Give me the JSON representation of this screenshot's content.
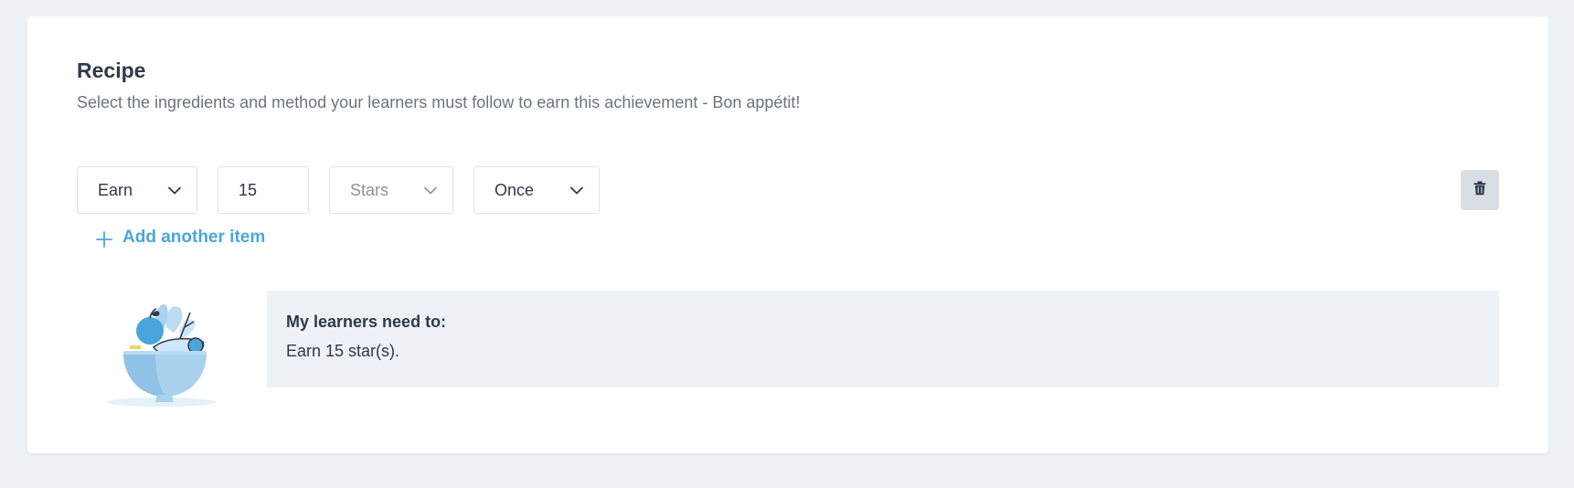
{
  "recipe": {
    "title": "Recipe",
    "subtitle": "Select the ingredients and method your learners must follow to earn this achievement - Bon appétit!"
  },
  "rule": {
    "action": "Earn",
    "amount": "15",
    "unit": "Stars",
    "frequency": "Once"
  },
  "add_item_label": "Add another item",
  "summary": {
    "heading": "My learners need to:",
    "text": "Earn 15 star(s)."
  },
  "colors": {
    "accent": "#4aa6da",
    "page_bg": "#eef1f6",
    "summary_bg": "#eef1f5",
    "trash_bg": "#d9dee5"
  }
}
